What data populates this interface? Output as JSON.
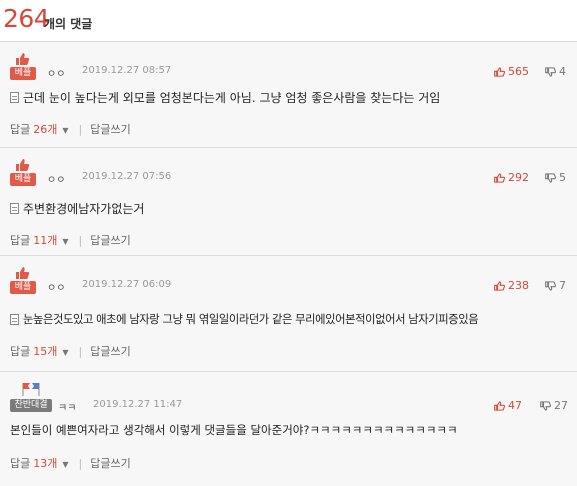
{
  "header": {
    "count": "264",
    "label": "개의 댓글"
  },
  "comments": [
    {
      "badge": "베플",
      "nick": "ㅇㅇ",
      "date": "2019.12.27 08:57",
      "likes": "565",
      "dislikes": "4",
      "text": "근데 눈이 높다는게 외모를 엄청본다는게 아님. 그냥 엄청 좋은사람을 찾는다는 거임",
      "reply_label": "답글",
      "reply_count": "26개",
      "write_label": "답글쓰기"
    },
    {
      "badge": "베플",
      "nick": "ㅇㅇ",
      "date": "2019.12.27 07:56",
      "likes": "292",
      "dislikes": "5",
      "text": "주변환경에남자가없는거",
      "reply_label": "답글",
      "reply_count": "11개",
      "write_label": "답글쓰기"
    },
    {
      "badge": "베플",
      "nick": "ㅇㅇ",
      "date": "2019.12.27 06:09",
      "likes": "238",
      "dislikes": "7",
      "text": "눈높은것도있고 애초에 남자랑 그냥 뭐 엮일일이라던가 같은 무리에있어본적이없어서 남자기피증있음",
      "reply_label": "답글",
      "reply_count": "15개",
      "write_label": "답글쓰기"
    },
    {
      "badge": "찬반대결",
      "nick": "ㅋㅋ",
      "date": "2019.12.27 11:47",
      "likes": "47",
      "dislikes": "27",
      "text": "본인들이 예쁜여자라고 생각해서 이렇게 댓글들을 달아준거야?ㅋㅋㅋㅋㅋㅋㅋㅋㅋㅋㅋㅋㅋㅋ",
      "reply_label": "답글",
      "reply_count": "13개",
      "write_label": "답글쓰기"
    }
  ],
  "icons": {
    "like": "thumbs-up-icon",
    "dislike": "thumbs-down-icon",
    "best": "thumb-badge-icon",
    "vs": "flags-icon",
    "doc": "document-icon",
    "caret": "caret-down-icon"
  },
  "colors": {
    "accent": "#d9473a",
    "best_badge": "#e05a4a",
    "vs_badge": "#7b7b7b"
  }
}
